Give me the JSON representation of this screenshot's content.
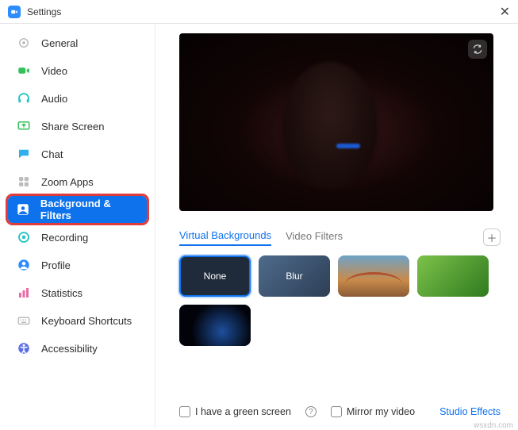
{
  "window": {
    "title": "Settings"
  },
  "sidebar": {
    "items": [
      {
        "label": "General"
      },
      {
        "label": "Video"
      },
      {
        "label": "Audio"
      },
      {
        "label": "Share Screen"
      },
      {
        "label": "Chat"
      },
      {
        "label": "Zoom Apps"
      },
      {
        "label": "Background & Filters"
      },
      {
        "label": "Recording"
      },
      {
        "label": "Profile"
      },
      {
        "label": "Statistics"
      },
      {
        "label": "Keyboard Shortcuts"
      },
      {
        "label": "Accessibility"
      }
    ],
    "active_index": 6
  },
  "tabs": {
    "items": [
      {
        "label": "Virtual Backgrounds"
      },
      {
        "label": "Video Filters"
      }
    ],
    "selected_index": 0
  },
  "backgrounds": {
    "items": [
      {
        "label": "None",
        "kind": "none"
      },
      {
        "label": "Blur",
        "kind": "blur"
      },
      {
        "label": "",
        "kind": "bridge"
      },
      {
        "label": "",
        "kind": "grass"
      },
      {
        "label": "",
        "kind": "earth"
      }
    ],
    "selected_index": 0
  },
  "options": {
    "green_screen_label": "I have a green screen",
    "mirror_label": "Mirror my video",
    "studio_label": "Studio Effects"
  },
  "watermark": "wsxdn.com"
}
